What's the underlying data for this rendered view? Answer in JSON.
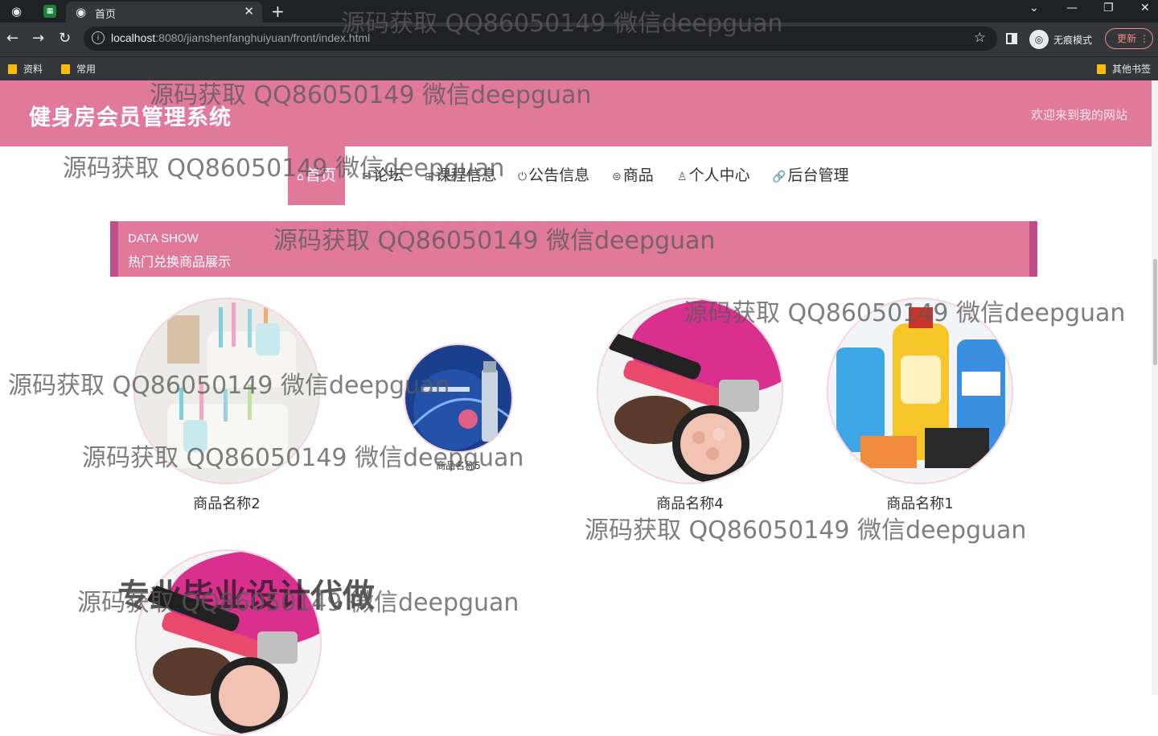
{
  "browser": {
    "tab_title": "首页",
    "url_host": "localhost",
    "url_rest": ":8080/jianshenfanghuiyuan/front/index.html",
    "incognito_label": "无痕模式",
    "update_label": "更新",
    "bookmarks": [
      "资料",
      "常用"
    ],
    "other_bookmarks": "其他书签"
  },
  "site": {
    "title": "健身房会员管理系统",
    "welcome": "欢迎来到我的网站"
  },
  "nav": [
    {
      "icon": "home-icon",
      "glyph": "⌂",
      "label": "首页",
      "active": true
    },
    {
      "icon": "mail-icon",
      "glyph": "✉",
      "label": "论坛",
      "active": false
    },
    {
      "icon": "grid-icon",
      "glyph": "⊞",
      "label": "课程信息",
      "active": false
    },
    {
      "icon": "power-icon",
      "glyph": "⏻",
      "label": "公告信息",
      "active": false
    },
    {
      "icon": "print-icon",
      "glyph": "⊜",
      "label": "商品",
      "active": false
    },
    {
      "icon": "user-icon",
      "glyph": "♙",
      "label": "个人中心",
      "active": false
    },
    {
      "icon": "link-icon",
      "glyph": "🔗",
      "label": "后台管理",
      "active": false
    }
  ],
  "section": {
    "en": "DATA SHOW",
    "cn": "热门兑换商品展示"
  },
  "products": [
    {
      "name": "商品名称2",
      "image": "toothbrush-holder"
    },
    {
      "name": "商品名称5",
      "image": "skincare-bottle"
    },
    {
      "name": "商品名称4",
      "image": "cosmetics"
    },
    {
      "name": "商品名称1",
      "image": "detergent-bottles"
    },
    {
      "name": "",
      "image": "cosmetics"
    }
  ],
  "overlay_text": "专业毕业设计代做",
  "watermark_text": "源码获取 QQ86050149 微信deepguan",
  "colors": {
    "accent": "#e17a9a",
    "accent_dark": "#c14e8c",
    "chrome_dark": "#202124",
    "chrome_mid": "#35363a"
  }
}
